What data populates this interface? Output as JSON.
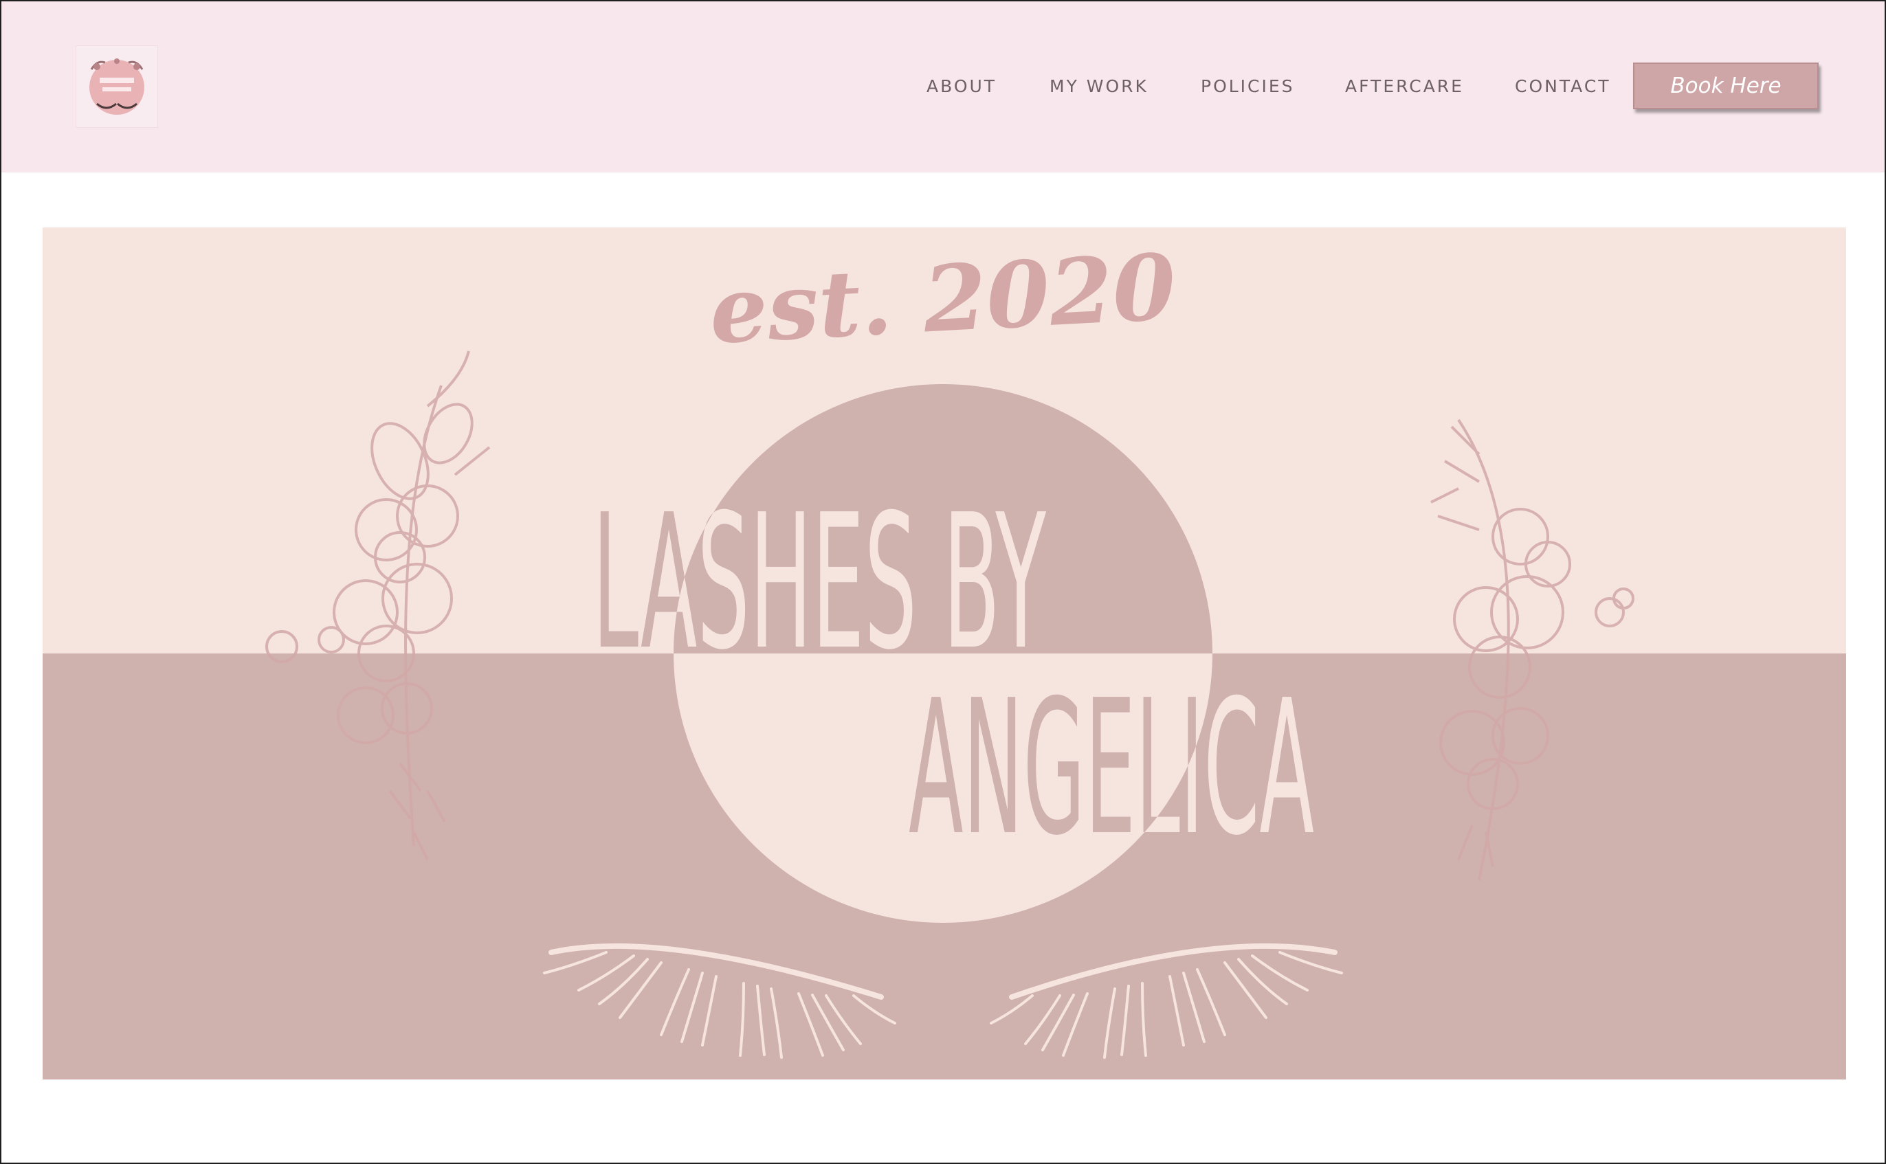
{
  "nav": {
    "items": [
      {
        "label": "ABOUT"
      },
      {
        "label": "MY WORK"
      },
      {
        "label": "POLICIES"
      },
      {
        "label": "AFTERCARE"
      },
      {
        "label": "CONTACT"
      }
    ],
    "book_label": "Book Here"
  },
  "logo": {
    "text": "lashes by angelica"
  },
  "banner": {
    "est": "est. 2020",
    "line1": "LASHES BY",
    "line2": "ANGELICA"
  },
  "colors": {
    "header_bg": "#f8e8ee",
    "banner_light": "#f6e4df",
    "banner_dark": "#cfb1ad",
    "button_bg": "#cfa6a8",
    "nav_text": "#6d6165"
  },
  "icons": {
    "logo": "lashes-logo-icon",
    "floral_left": "floral-branch-icon",
    "floral_right": "floral-branch-icon",
    "lash_left": "eyelash-icon",
    "lash_right": "eyelash-icon"
  }
}
